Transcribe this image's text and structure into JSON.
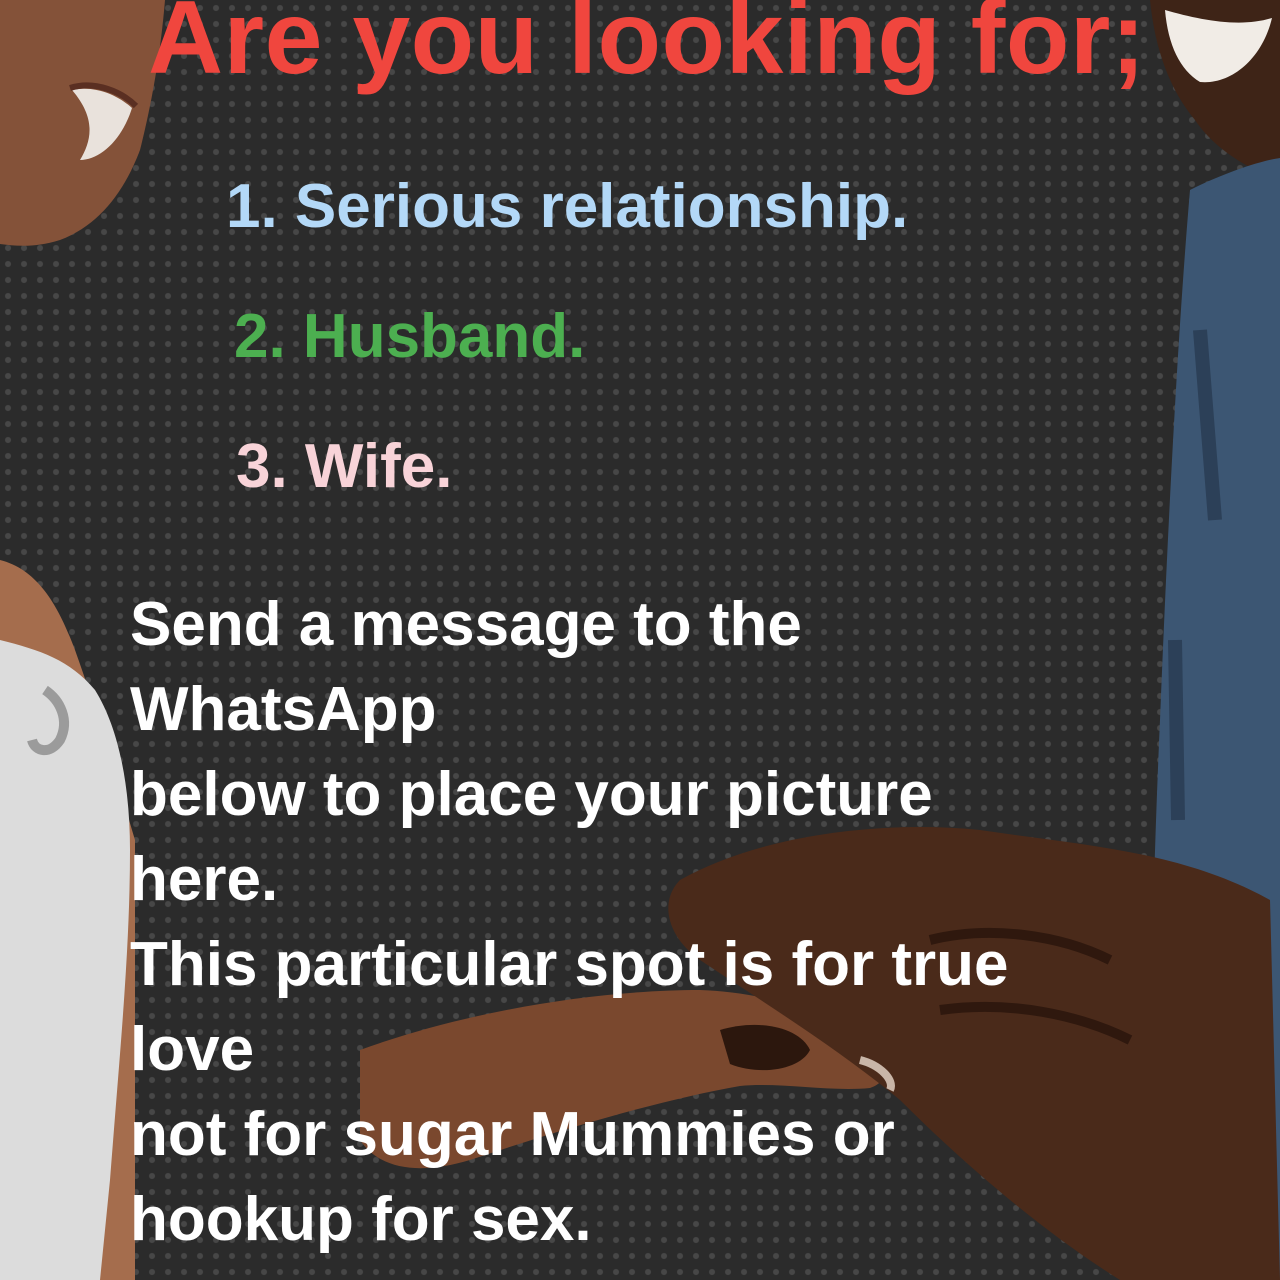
{
  "heading": {
    "text": "Are you looking for;",
    "color": "#f0463e"
  },
  "options": [
    {
      "label": "1. Serious relationship.",
      "color": "#b3d8f7"
    },
    {
      "label": "2. Husband.",
      "color": "#4caf50"
    },
    {
      "label": "3. Wife.",
      "color": "#f8d3d8"
    }
  ],
  "message": {
    "lines": [
      "Send a message to the",
      "WhatsApp",
      "below to place your picture",
      "here.",
      "This particular spot is for true",
      "love",
      "not for sugar Mummies or",
      "hookup for sex."
    ],
    "color": "#ffffff"
  },
  "photo": {
    "subjects": [
      "smiling-woman",
      "smiling-man",
      "hands-with-ring"
    ],
    "background_pattern": "dark-perforated-dots"
  }
}
